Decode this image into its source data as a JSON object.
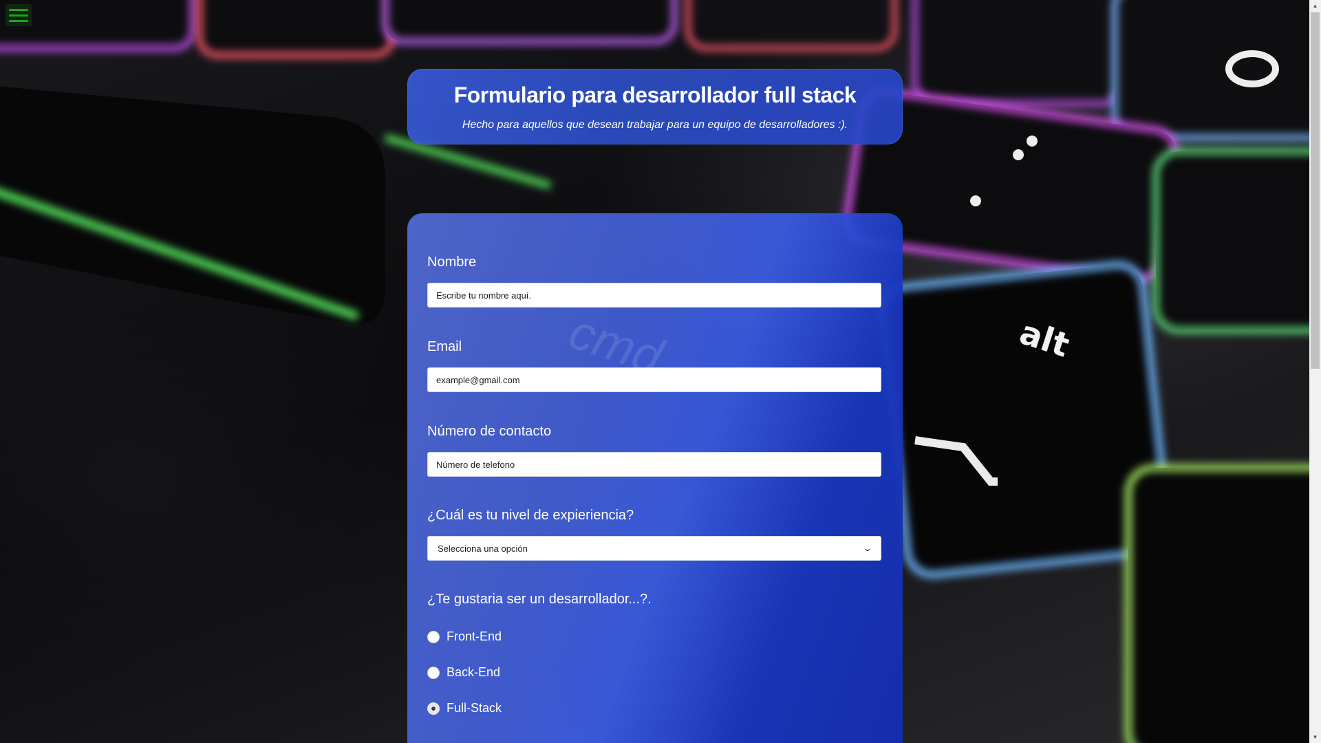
{
  "header": {
    "title": "Formulario para desarrollador full stack",
    "subtitle": "Hecho para aquellos que desean trabajar para un equipo de desarrolladores :)."
  },
  "menu": {
    "icon": "hamburger-menu-icon",
    "color": "#1fa31f"
  },
  "form": {
    "fields": {
      "name": {
        "label": "Nombre",
        "placeholder": "Escribe tu nombre aquí."
      },
      "email": {
        "label": "Email",
        "placeholder": "example@gmail.com"
      },
      "phone": {
        "label": "Número de contacto",
        "placeholder": "Número de telefono"
      }
    },
    "experience": {
      "label": "¿Cuál es tu nivel de expieriencia?",
      "selected": "Selecciona una opción"
    },
    "role": {
      "question": "¿Te gustaria ser un desarrollador...?.",
      "options": [
        {
          "label": "Front-End",
          "checked": false
        },
        {
          "label": "Back-End",
          "checked": false
        },
        {
          "label": "Full-Stack",
          "checked": true
        }
      ]
    }
  },
  "colors": {
    "card_blue": "#3b5fe0",
    "card_dark_blue": "#1a3aae",
    "text": "#ffffff"
  }
}
